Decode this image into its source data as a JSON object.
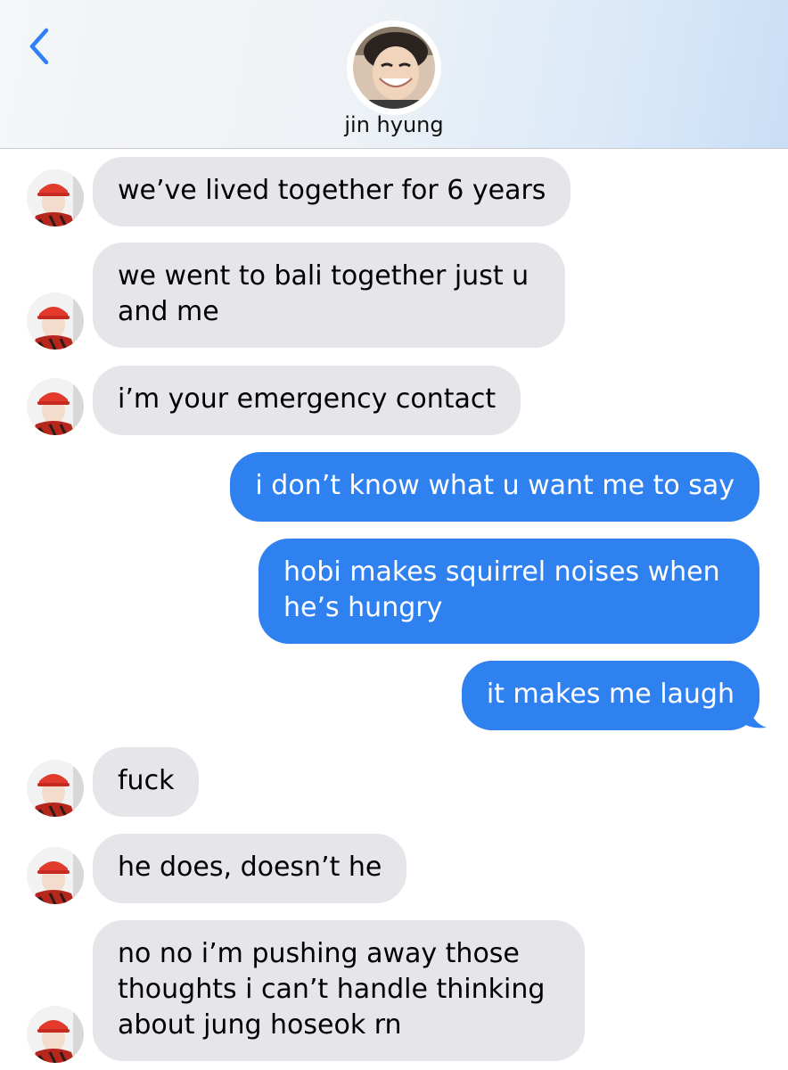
{
  "header": {
    "contact_name": "jin hyung"
  },
  "colors": {
    "incoming_bubble": "#e5e5ea",
    "outgoing_bubble": "#3081f0",
    "back_chevron": "#2f7ff5"
  },
  "messages": [
    {
      "from": "them",
      "text": "we’ve lived together for 6 years"
    },
    {
      "from": "them",
      "text": "we went to bali together just u and me"
    },
    {
      "from": "them",
      "text": "i’m your emergency contact"
    },
    {
      "from": "me",
      "text": "i don’t know what u want me to say"
    },
    {
      "from": "me",
      "text": "hobi makes squirrel noises when he’s hungry"
    },
    {
      "from": "me",
      "text": "it makes me laugh"
    },
    {
      "from": "them",
      "text": "fuck"
    },
    {
      "from": "them",
      "text": "he does, doesn’t he"
    },
    {
      "from": "them",
      "text": "no no i’m pushing away those thoughts i can’t handle thinking about jung hoseok rn"
    }
  ]
}
